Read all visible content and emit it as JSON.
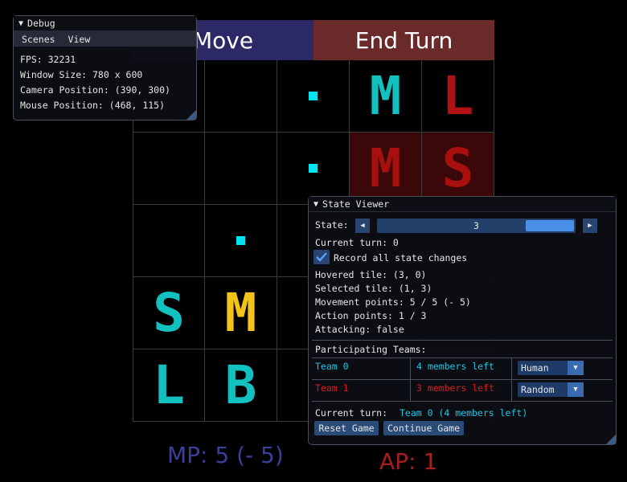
{
  "buttons": {
    "move": "Move",
    "end_turn": "End Turn"
  },
  "board": {
    "dots": [
      [
        2,
        0
      ],
      [
        2,
        1
      ],
      [
        1,
        2
      ]
    ],
    "units": [
      {
        "col": 3,
        "row": 0,
        "letter": "M",
        "color": "#13c0c0",
        "bg": "#000000"
      },
      {
        "col": 4,
        "row": 0,
        "letter": "L",
        "color": "#b01212",
        "bg": "#000000"
      },
      {
        "col": 3,
        "row": 1,
        "letter": "M",
        "color": "#a80f0f",
        "bg": "#3a0808"
      },
      {
        "col": 4,
        "row": 1,
        "letter": "S",
        "color": "#a80f0f",
        "bg": "#3a0808"
      },
      {
        "col": 0,
        "row": 3,
        "letter": "S",
        "color": "#13c0c0",
        "bg": "#000000"
      },
      {
        "col": 1,
        "row": 3,
        "letter": "M",
        "color": "#f2c41a",
        "bg": "#000000"
      },
      {
        "col": 0,
        "row": 4,
        "letter": "L",
        "color": "#13c0c0",
        "bg": "#000000"
      },
      {
        "col": 1,
        "row": 4,
        "letter": "B",
        "color": "#13c0c0",
        "bg": "#000000"
      }
    ]
  },
  "status": {
    "mp": "MP: 5 (- 5)",
    "ap": "AP: 1"
  },
  "debug": {
    "title": "Debug",
    "menu": [
      "Scenes",
      "View"
    ],
    "fps": "FPS: 32231",
    "window_size": "Window Size: 780 x 600",
    "camera_position": "Camera Position: (390, 300)",
    "mouse_position": "Mouse Position: (468, 115)"
  },
  "state_viewer": {
    "title": "State Viewer",
    "state_label": "State:",
    "state_value": "3",
    "current_turn": "Current turn: 0",
    "record_label": "Record all state changes",
    "hovered_tile": "Hovered tile: (3, 0)",
    "selected_tile": "Selected tile: (1, 3)",
    "movement_points": "Movement points: 5 / 5 (- 5)",
    "action_points": "Action points: 1 / 3",
    "attacking": "Attacking: false",
    "teams_header": "Participating Teams:",
    "teams": [
      {
        "name": "Team 0",
        "members": "4 members left",
        "control": "Human",
        "color": "#19c6e6"
      },
      {
        "name": "Team 1",
        "members": "3 members left",
        "control": "Random",
        "color": "#d41e1e"
      }
    ],
    "current_turn_label": "Current turn:",
    "current_turn_value": "Team 0 (4 members left)",
    "reset_label": "Reset Game",
    "continue_label": "Continue Game"
  }
}
